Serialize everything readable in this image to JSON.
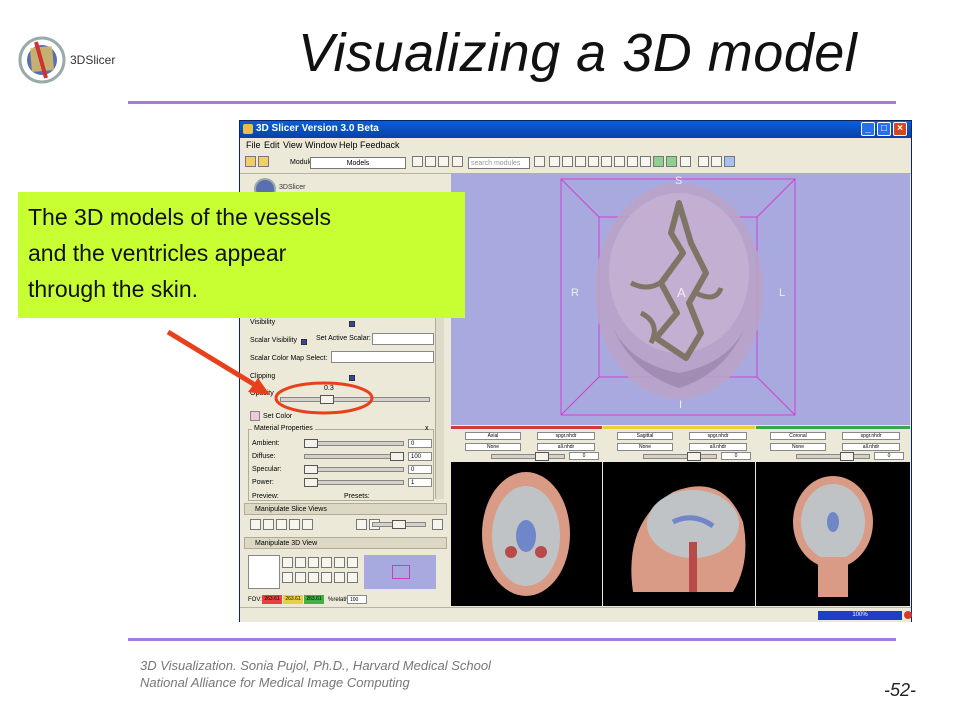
{
  "slide": {
    "title": "Visualizing a 3D model",
    "logo_text": "3DSlicer",
    "footer_line1": "3D Visualization. Sonia Pujol, Ph.D., Harvard Medical School",
    "footer_line2": "National Alliance for Medical Image Computing",
    "page_number": "-52-",
    "accent_color": "#a77bd9"
  },
  "callout": {
    "lines": [
      "The 3D models of the vessels",
      "and the ventricles appear",
      "through the skin."
    ],
    "background": "#c8ff33",
    "arrow_color": "#e8401c"
  },
  "window": {
    "title": "3D Slicer Version 3.0 Beta",
    "menu": [
      "File",
      "Edit",
      "View",
      "Window",
      "Help",
      "Feedback"
    ],
    "toolbar": {
      "modules_label": "Modules:",
      "modules_value": "Models",
      "search_placeholder": "search modules"
    }
  },
  "panel": {
    "logo_text": "3DSlicer",
    "visibility_label": "Visibility",
    "scalar_visibility_label": "Scalar Visibility",
    "set_active_scalar_label": "Set Active Scalar:",
    "scalar_color_map_label": "Scalar Color Map Select:",
    "clipping_label": "Clipping",
    "opacity_label": "Opacity",
    "opacity_value": "0.3",
    "set_color_label": "Set Color",
    "material_title": "Material Properties",
    "material_close": "x",
    "material": [
      {
        "label": "Ambient:",
        "value": "0"
      },
      {
        "label": "Diffuse:",
        "value": "100"
      },
      {
        "label": "Specular:",
        "value": "0"
      },
      {
        "label": "Power:",
        "value": "1"
      }
    ],
    "preview_label": "Preview:",
    "presets_label": "Presets:",
    "manipulate_slice_title": "Manipulate Slice Views",
    "manipulate_3d_title": "Manipulate 3D View",
    "fov_label": "FOV:",
    "fov_values": [
      "263.61",
      "263.61",
      "263.61"
    ],
    "relative_label": "%relative:",
    "relative_value": "100"
  },
  "view3d": {
    "labels": {
      "top": "S",
      "left": "R",
      "center": "A",
      "right": "L",
      "bottom": "I"
    },
    "background": "#a8aadf"
  },
  "slices": [
    {
      "name": "Axial",
      "bar_color": "#d23a3a",
      "volume": "spgr.nhdr",
      "label": "None",
      "label_volume": "all.nhdr",
      "value": "0"
    },
    {
      "name": "Sagittal",
      "bar_color": "#e8d23a",
      "volume": "spgr.nhdr",
      "label": "None",
      "label_volume": "all.nhdr",
      "value": "0"
    },
    {
      "name": "Coronal",
      "bar_color": "#3aa84a",
      "volume": "spgr.nhdr",
      "label": "None",
      "label_volume": "all.nhdr",
      "value": "0"
    }
  ],
  "status": {
    "progress_text": "100%",
    "progress": 1.0
  }
}
